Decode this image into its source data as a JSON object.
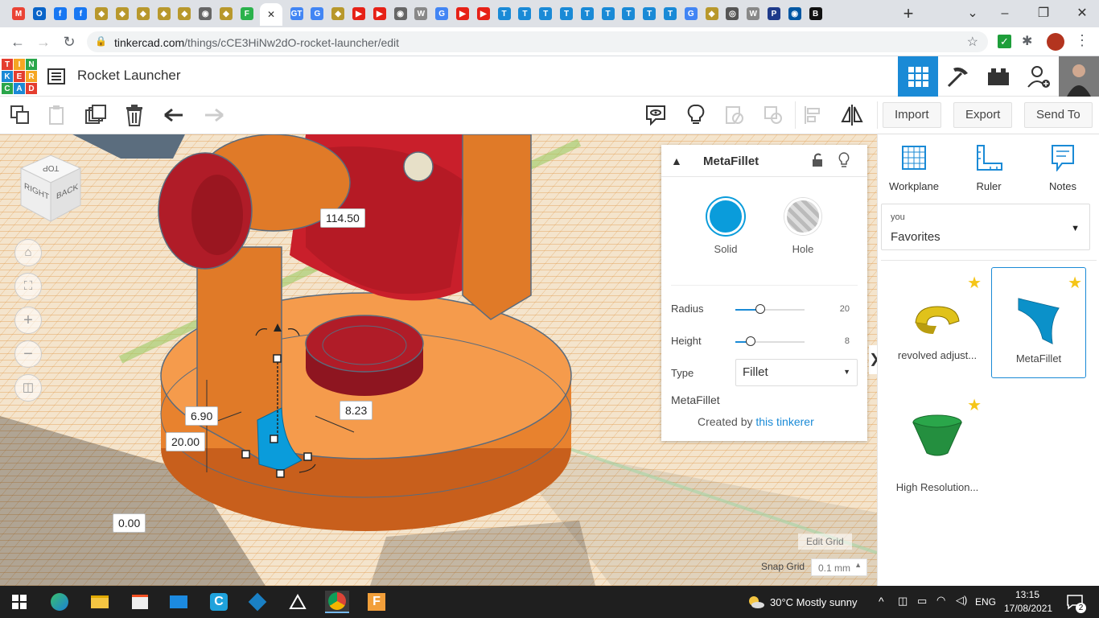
{
  "browser": {
    "url_host": "tinkercad.com",
    "url_path": "/things/cCE3HiNw2dO-rocket-launcher/edit",
    "tab_icons": [
      "gmail-icon",
      "outlook-icon",
      "facebook-icon",
      "facebook-icon",
      "generic-icon",
      "generic-icon",
      "generic-icon",
      "generic-icon",
      "generic-icon",
      "globe-icon",
      "generic-icon",
      "feedly-icon",
      "tinkercad-icon",
      "google-translate-icon",
      "google-icon",
      "generic-icon",
      "youtube-icon",
      "youtube-icon",
      "globe-icon",
      "wikipedia-icon",
      "google-icon",
      "youtube-icon",
      "youtube-icon",
      "tinkercad-icon",
      "tinkercad-icon",
      "tinkercad-icon",
      "tinkercad-icon",
      "tinkercad-icon",
      "tinkercad-icon",
      "tinkercad-icon",
      "tinkercad-icon",
      "tinkercad-icon",
      "google-icon",
      "generic-icon",
      "chrome-icon",
      "wikipedia-icon",
      "p21-icon",
      "eye-icon",
      "bbc-icon"
    ],
    "active_tab_close": "✕"
  },
  "app": {
    "logo_letters": [
      "T",
      "I",
      "N",
      "K",
      "E",
      "R",
      "C",
      "A",
      "D"
    ],
    "design_title": "Rocket Launcher",
    "toolbar": {
      "import_label": "Import",
      "export_label": "Export",
      "send_to_label": "Send To"
    }
  },
  "workspace": {
    "dims": {
      "height_top": "114.50",
      "d1": "6.90",
      "d2": "20.00",
      "d3": "8.23",
      "elevation": "0.00"
    },
    "viewcube": {
      "top": "TOP",
      "right": "RIGHT",
      "back": "BACK"
    },
    "edit_grid_label": "Edit Grid",
    "snap_grid_label": "Snap Grid",
    "snap_grid_value": "0.1 mm"
  },
  "inspector": {
    "title": "MetaFillet",
    "solid_label": "Solid",
    "hole_label": "Hole",
    "solid_color": "#0a9cdb",
    "params": [
      {
        "label": "Radius",
        "value": "20"
      },
      {
        "label": "Height",
        "value": "8"
      }
    ],
    "type_label": "Type",
    "type_value": "Fillet",
    "shape_name": "MetaFillet",
    "created_by_prefix": "Created by",
    "created_by_link": "this tinkerer"
  },
  "right_panel": {
    "tools": [
      {
        "label": "Workplane"
      },
      {
        "label": "Ruler"
      },
      {
        "label": "Notes"
      }
    ],
    "fav_owner": "you",
    "fav_category": "Favorites",
    "shapes": [
      {
        "label": "revolved adjust..."
      },
      {
        "label": "MetaFillet"
      },
      {
        "label": "High Resolution..."
      }
    ]
  },
  "taskbar": {
    "weather": "30°C  Mostly sunny",
    "lang": "ENG",
    "time": "13:15",
    "date": "17/08/2021",
    "notif_count": "2"
  }
}
